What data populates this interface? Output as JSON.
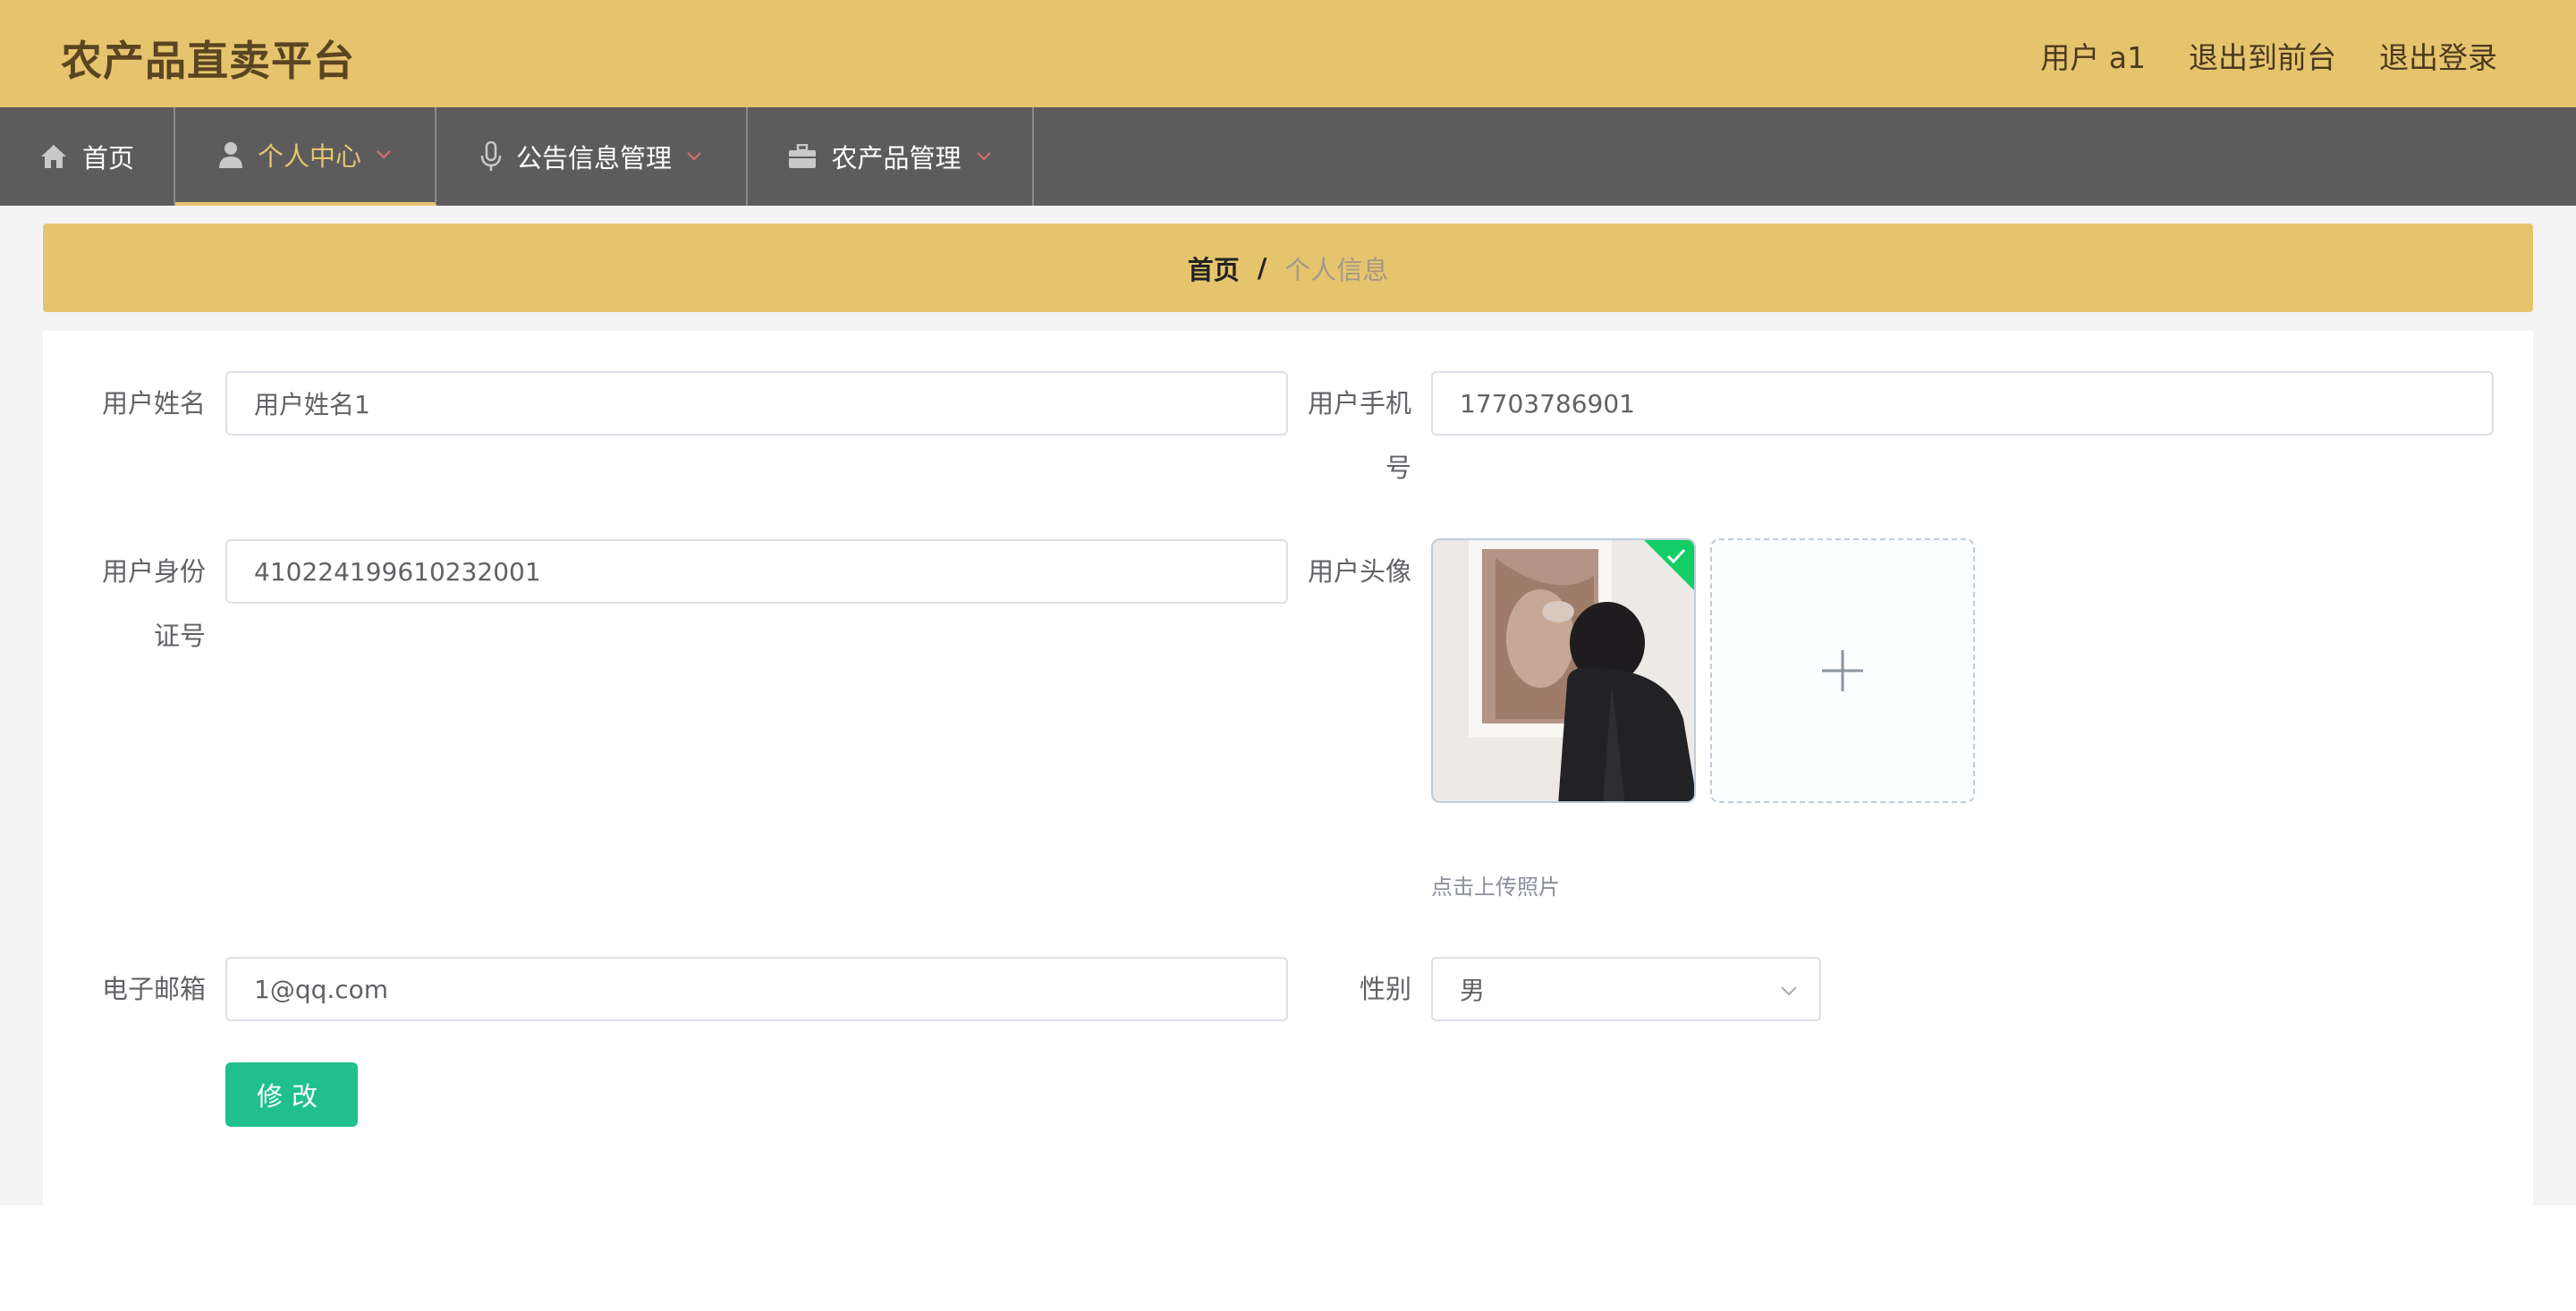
{
  "header": {
    "brand": "农产品直卖平台",
    "user_label": "用户 a1",
    "exit_front_label": "退出到前台",
    "logout_label": "退出登录"
  },
  "nav": {
    "items": [
      {
        "label": "首页",
        "icon": "home-icon"
      },
      {
        "label": "个人中心",
        "icon": "user-icon",
        "active": true
      },
      {
        "label": "公告信息管理",
        "icon": "microphone-icon"
      },
      {
        "label": "农产品管理",
        "icon": "briefcase-icon"
      }
    ]
  },
  "breadcrumb": {
    "home": "首页",
    "separator": "/",
    "current": "个人信息"
  },
  "form": {
    "name": {
      "label": "用户姓名",
      "value": "用户姓名1"
    },
    "phone": {
      "label_line1": "用户手机",
      "label_line2": "号",
      "value": "17703786901"
    },
    "id_card": {
      "label_line1": "用户身份",
      "label_line2": "证号",
      "value": "410224199610232001"
    },
    "avatar": {
      "label": "用户头像",
      "tip": "点击上传照片",
      "uploaded": true
    },
    "email": {
      "label": "电子邮箱",
      "value": "1@qq.com"
    },
    "gender": {
      "label": "性别",
      "value": "男"
    },
    "submit_label": "修改"
  },
  "colors": {
    "header_bg": "#e6c46e",
    "nav_bg": "#5d5c5d",
    "accent": "#e6c46e",
    "submit": "#1fc08e",
    "upload_success": "#13ce66"
  }
}
